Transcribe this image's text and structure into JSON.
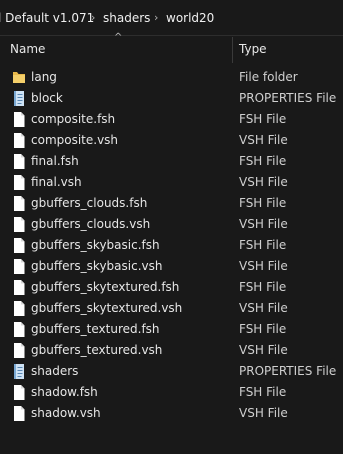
{
  "breadcrumb": {
    "items": [
      "l Default v1.071",
      "shaders",
      "world20"
    ],
    "separator": "›"
  },
  "columns": {
    "sort_indicator": "^",
    "name": "Name",
    "type": "Type"
  },
  "colors": {
    "background": "#191919",
    "text": "#e6e6e6",
    "folder": "#f2c85b",
    "file_icon": "#ffffff",
    "properties_icon": "#9fc6e8"
  },
  "files": [
    {
      "name": "lang",
      "type": "File folder",
      "icon": "folder-icon"
    },
    {
      "name": "block",
      "type": "PROPERTIES File",
      "icon": "properties-file-icon"
    },
    {
      "name": "composite.fsh",
      "type": "FSH File",
      "icon": "file-icon"
    },
    {
      "name": "composite.vsh",
      "type": "VSH File",
      "icon": "file-icon"
    },
    {
      "name": "final.fsh",
      "type": "FSH File",
      "icon": "file-icon"
    },
    {
      "name": "final.vsh",
      "type": "VSH File",
      "icon": "file-icon"
    },
    {
      "name": "gbuffers_clouds.fsh",
      "type": "FSH File",
      "icon": "file-icon"
    },
    {
      "name": "gbuffers_clouds.vsh",
      "type": "VSH File",
      "icon": "file-icon"
    },
    {
      "name": "gbuffers_skybasic.fsh",
      "type": "FSH File",
      "icon": "file-icon"
    },
    {
      "name": "gbuffers_skybasic.vsh",
      "type": "VSH File",
      "icon": "file-icon"
    },
    {
      "name": "gbuffers_skytextured.fsh",
      "type": "FSH File",
      "icon": "file-icon"
    },
    {
      "name": "gbuffers_skytextured.vsh",
      "type": "VSH File",
      "icon": "file-icon"
    },
    {
      "name": "gbuffers_textured.fsh",
      "type": "FSH File",
      "icon": "file-icon"
    },
    {
      "name": "gbuffers_textured.vsh",
      "type": "VSH File",
      "icon": "file-icon"
    },
    {
      "name": "shaders",
      "type": "PROPERTIES File",
      "icon": "properties-file-icon"
    },
    {
      "name": "shadow.fsh",
      "type": "FSH File",
      "icon": "file-icon"
    },
    {
      "name": "shadow.vsh",
      "type": "VSH File",
      "icon": "file-icon"
    }
  ]
}
